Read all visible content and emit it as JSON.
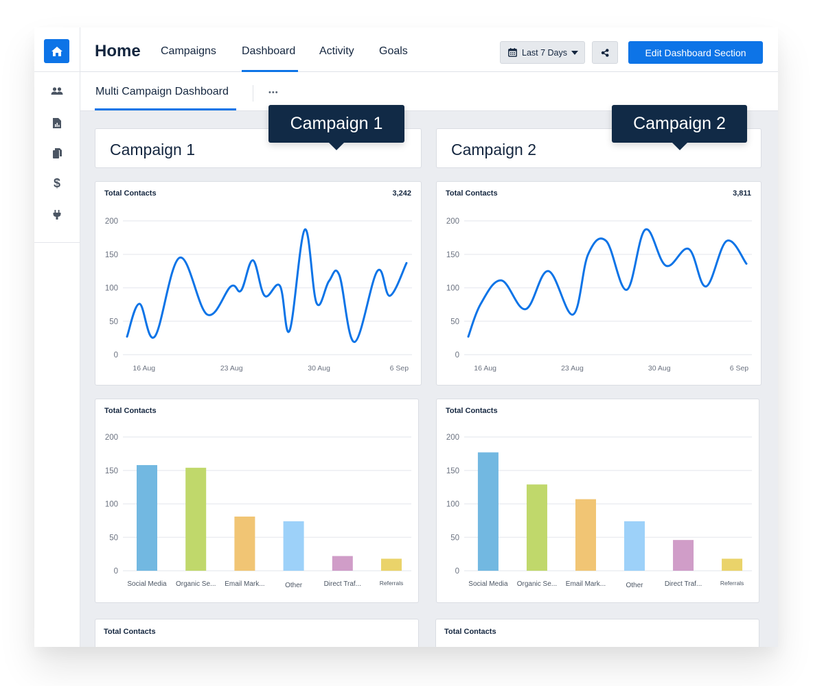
{
  "nav": {
    "home_title": "Home",
    "tabs": [
      {
        "label": "Campaigns",
        "active": false
      },
      {
        "label": "Dashboard",
        "active": true
      },
      {
        "label": "Activity",
        "active": false
      },
      {
        "label": "Goals",
        "active": false
      }
    ],
    "date_range": "Last 7 Days",
    "edit_button": "Edit Dashboard Section"
  },
  "sidebar": {
    "items": [
      {
        "icon": "home-icon",
        "active": true
      },
      {
        "icon": "users-icon"
      },
      {
        "icon": "report-icon"
      },
      {
        "icon": "copy-icon"
      },
      {
        "icon": "dollar-icon"
      },
      {
        "icon": "plug-icon"
      }
    ]
  },
  "subnav": {
    "tab": "Multi Campaign Dashboard",
    "more": "•••"
  },
  "colors": {
    "accent": "#0d74e7",
    "tooltip_bg": "#112a46",
    "text": "#14263f",
    "background": "#ebedf1"
  },
  "campaigns": [
    {
      "title": "Campaign 1",
      "tooltip": "Campaign 1",
      "line_card": {
        "title": "Total Contacts",
        "value": "3,242"
      },
      "bar_card": {
        "title": "Total Contacts"
      },
      "bottom_card": {
        "title": "Total Contacts"
      }
    },
    {
      "title": "Campaign 2",
      "tooltip": "Campaign 2",
      "line_card": {
        "title": "Total Contacts",
        "value": "3,811"
      },
      "bar_card": {
        "title": "Total Contacts"
      },
      "bottom_card": {
        "title": "Total Contacts"
      }
    }
  ],
  "chart_data": [
    {
      "type": "line",
      "title": "Total Contacts",
      "total": "3,242",
      "xlabel": "",
      "ylabel": "",
      "x_unit": "days since 15 Aug",
      "x_range": [
        0,
        23
      ],
      "x_ticks": [
        {
          "x": 1.4,
          "label": "16 Aug"
        },
        {
          "x": 8.6,
          "label": "23 Aug"
        },
        {
          "x": 15.8,
          "label": "30 Aug"
        },
        {
          "x": 22.4,
          "label": "6 Sep"
        }
      ],
      "ylim": [
        0,
        200
      ],
      "y_ticks": [
        0,
        50,
        100,
        150,
        200
      ],
      "grid": true,
      "color": "#0d74e7",
      "points": [
        [
          0,
          27
        ],
        [
          1.02,
          76
        ],
        [
          2.28,
          27
        ],
        [
          4.33,
          145
        ],
        [
          6.6,
          60
        ],
        [
          8.54,
          102
        ],
        [
          9.39,
          96
        ],
        [
          10.36,
          141
        ],
        [
          11.33,
          88
        ],
        [
          12.58,
          103
        ],
        [
          13.38,
          36
        ],
        [
          14.63,
          187
        ],
        [
          15.6,
          77
        ],
        [
          16.62,
          110
        ],
        [
          17.47,
          119
        ],
        [
          18.72,
          19
        ],
        [
          20.6,
          125
        ],
        [
          21.63,
          88
        ],
        [
          23,
          137
        ]
      ]
    },
    {
      "type": "line",
      "title": "Total Contacts",
      "total": "3,811",
      "xlabel": "",
      "ylabel": "",
      "x_unit": "days since 15 Aug",
      "x_range": [
        0,
        23
      ],
      "x_ticks": [
        {
          "x": 1.4,
          "label": "16 Aug"
        },
        {
          "x": 8.6,
          "label": "23 Aug"
        },
        {
          "x": 15.8,
          "label": "30 Aug"
        },
        {
          "x": 22.4,
          "label": "6 Sep"
        }
      ],
      "ylim": [
        0,
        200
      ],
      "y_ticks": [
        0,
        50,
        100,
        150,
        200
      ],
      "grid": true,
      "color": "#0d74e7",
      "points": [
        [
          0,
          27
        ],
        [
          1.03,
          76
        ],
        [
          2.73,
          111
        ],
        [
          4.73,
          68
        ],
        [
          6.61,
          125
        ],
        [
          8.66,
          60
        ],
        [
          9.91,
          150
        ],
        [
          11.4,
          170
        ],
        [
          13.1,
          97
        ],
        [
          14.64,
          187
        ],
        [
          16.35,
          133
        ],
        [
          18.23,
          158
        ],
        [
          19.66,
          102
        ],
        [
          21.37,
          170
        ],
        [
          23,
          136
        ]
      ]
    },
    {
      "type": "bar",
      "title": "Total Contacts",
      "categories": [
        "Social Media",
        "Organic Se...",
        "Email Mark...",
        "Other",
        "Direct Traf...",
        "Referrals"
      ],
      "values": [
        158,
        154,
        81,
        74,
        22,
        18
      ],
      "colors": [
        "#72b8e1",
        "#c0d86b",
        "#f1c574",
        "#9dd1f9",
        "#d09dc8",
        "#ead36a"
      ],
      "ylim": [
        0,
        200
      ],
      "y_ticks": [
        0,
        50,
        100,
        150,
        200
      ],
      "grid": true
    },
    {
      "type": "bar",
      "title": "Total Contacts",
      "categories": [
        "Social Media",
        "Organic Se...",
        "Email Mark...",
        "Other",
        "Direct Traf...",
        "Referrals"
      ],
      "values": [
        177,
        129,
        107,
        74,
        46,
        18
      ],
      "colors": [
        "#72b8e1",
        "#c0d86b",
        "#f1c574",
        "#9dd1f9",
        "#d09dc8",
        "#ead36a"
      ],
      "ylim": [
        0,
        200
      ],
      "y_ticks": [
        0,
        50,
        100,
        150,
        200
      ],
      "grid": true
    }
  ]
}
